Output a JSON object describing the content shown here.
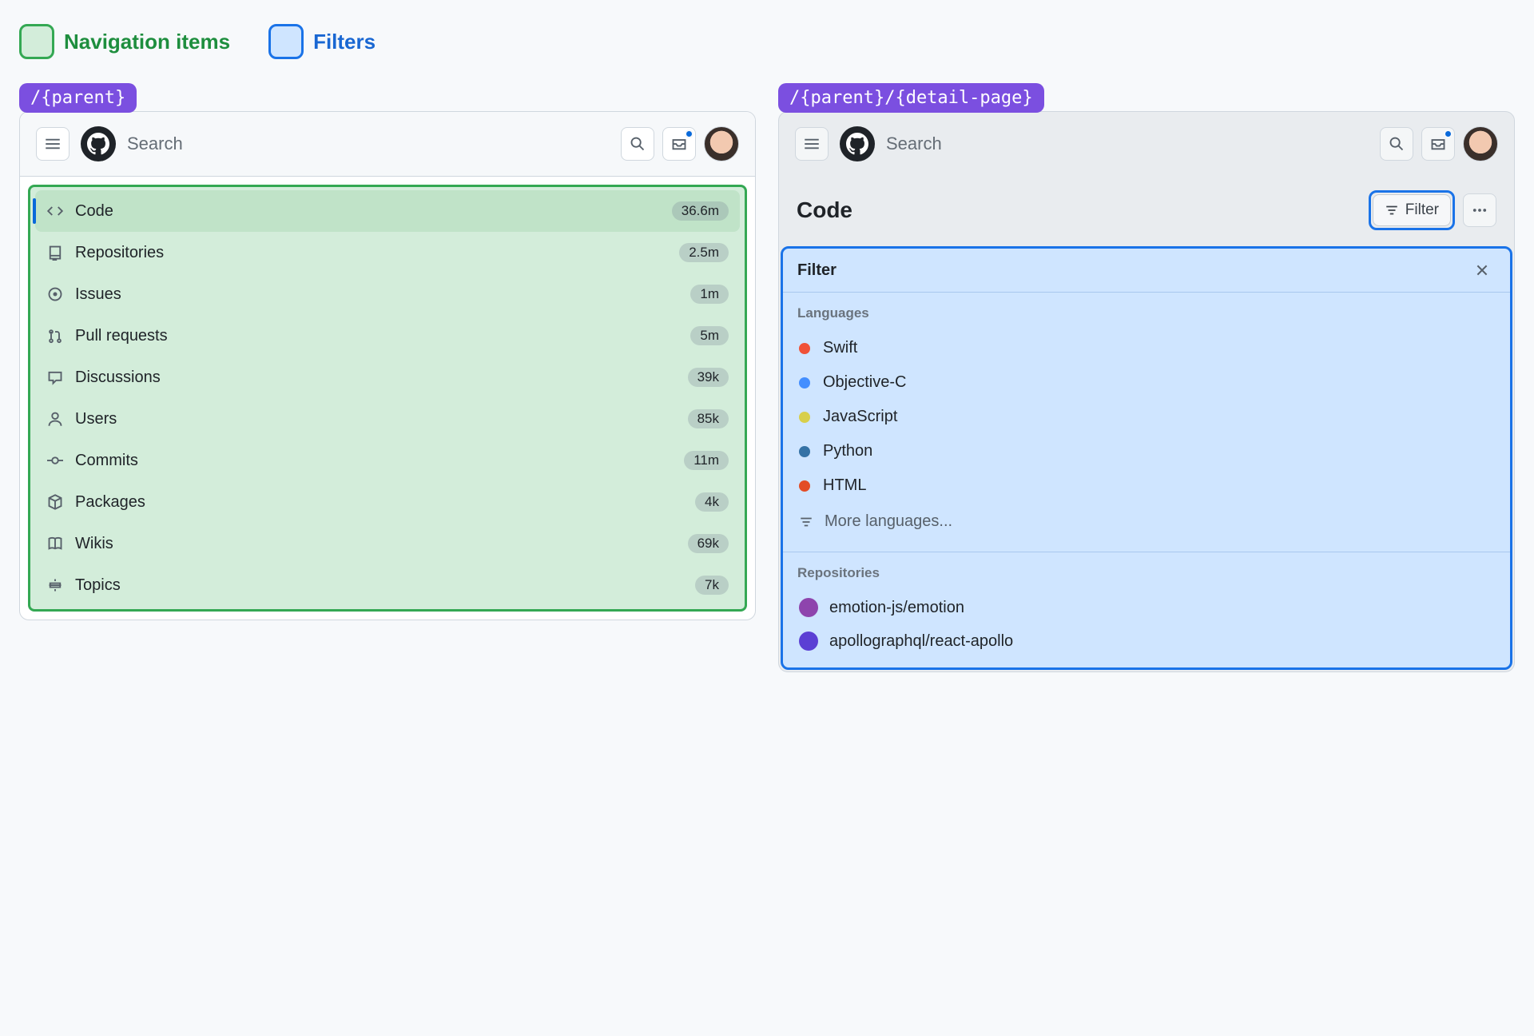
{
  "legend": {
    "nav": "Navigation items",
    "filters": "Filters"
  },
  "routes": {
    "parent": "/{parent}",
    "detail": "/{parent}/{detail-page}"
  },
  "topbar": {
    "search_label": "Search"
  },
  "nav": {
    "items": [
      {
        "label": "Code",
        "count": "36.6m",
        "icon": "code"
      },
      {
        "label": "Repositories",
        "count": "2.5m",
        "icon": "repo"
      },
      {
        "label": "Issues",
        "count": "1m",
        "icon": "issue"
      },
      {
        "label": "Pull requests",
        "count": "5m",
        "icon": "pr"
      },
      {
        "label": "Discussions",
        "count": "39k",
        "icon": "discussion"
      },
      {
        "label": "Users",
        "count": "85k",
        "icon": "user"
      },
      {
        "label": "Commits",
        "count": "11m",
        "icon": "commit"
      },
      {
        "label": "Packages",
        "count": "4k",
        "icon": "package"
      },
      {
        "label": "Wikis",
        "count": "69k",
        "icon": "wiki"
      },
      {
        "label": "Topics",
        "count": "7k",
        "icon": "topic"
      }
    ]
  },
  "detail": {
    "title": "Code",
    "filter_button": "Filter",
    "sheet_title": "Filter",
    "languages_label": "Languages",
    "languages": [
      {
        "name": "Swift",
        "color": "#f05138"
      },
      {
        "name": "Objective-C",
        "color": "#438eff"
      },
      {
        "name": "JavaScript",
        "color": "#d8cf4b"
      },
      {
        "name": "Python",
        "color": "#3572A5"
      },
      {
        "name": "HTML",
        "color": "#e34c26"
      }
    ],
    "more_languages": "More languages...",
    "repositories_label": "Repositories",
    "repositories": [
      {
        "name": "emotion-js/emotion",
        "avatar_color": "#8e44ad"
      },
      {
        "name": "apollographql/react-apollo",
        "avatar_color": "#5b3fd4"
      }
    ]
  }
}
